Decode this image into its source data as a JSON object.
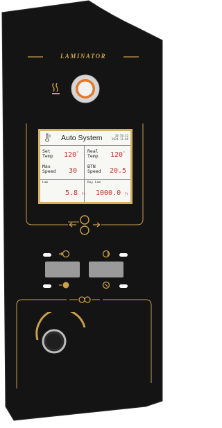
{
  "brand": {
    "text": "LAMINATOR"
  },
  "screen": {
    "title": "Auto System",
    "date_line1": "10:50:32",
    "date_line2": "2024-11-06",
    "set_temp_label_1": "Set",
    "set_temp_label_2": "Temp",
    "set_temp_value": "120",
    "real_temp_label_1": "Real",
    "real_temp_label_2": "Temp",
    "real_temp_value": "120",
    "temp_unit": "°",
    "max_speed_label_1": "Max",
    "max_speed_label_2": "Speed",
    "max_speed_value": "30",
    "btn_speed_label_1": "BTN",
    "btn_speed_label_2": "Speed",
    "btn_speed_value": "20.5",
    "lam_label": "Lam",
    "lam_value": "5.8",
    "day_lam_label": "Day Lam",
    "day_lam_value": "1000.0",
    "length_unit": "Ft"
  },
  "colors": {
    "panel": "#141414",
    "gold": "#c9a04b",
    "accent_orange": "#e07a2a",
    "value_red": "#c0392b",
    "key_gray": "#9a9a9a"
  }
}
